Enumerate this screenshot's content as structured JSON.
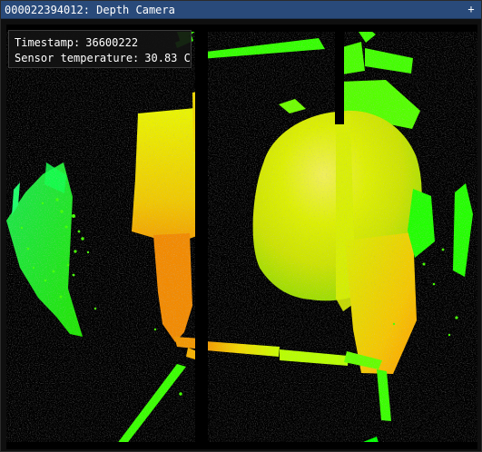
{
  "window": {
    "title": "000022394012: Depth Camera",
    "collapse_glyph": "+",
    "titlebar_color": "#294a7a"
  },
  "overlay": {
    "timestamp_label": "Timestamp:",
    "timestamp_value": "36600222",
    "sensor_temp_label": "Sensor temperature:",
    "sensor_temp_value": "30.83 C"
  },
  "depth_image": {
    "description_colors": {
      "near": "#ffd000",
      "mid": "#d8ff00",
      "far": "#00ff00"
    }
  }
}
